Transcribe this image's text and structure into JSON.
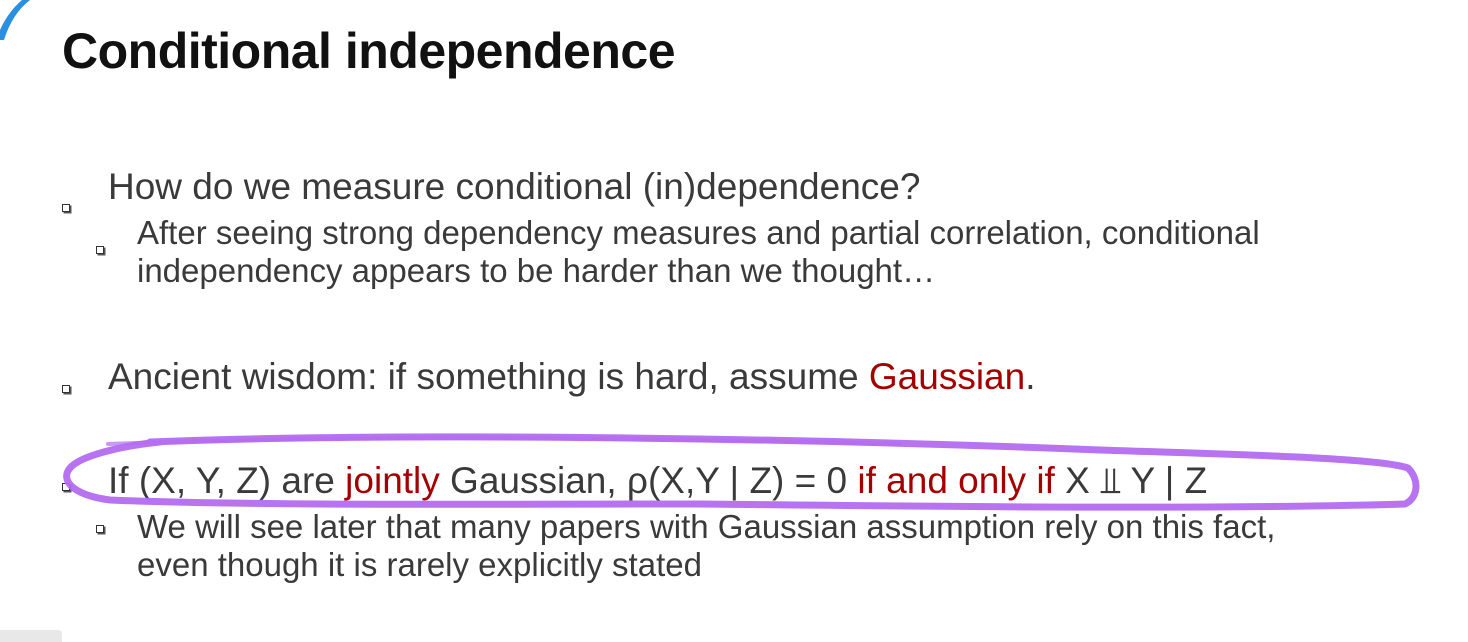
{
  "slide": {
    "title": "Conditional independence",
    "bullets": {
      "b1": {
        "text": "How do we measure conditional (in)dependence?",
        "sub": {
          "line1": "After seeing strong dependency measures and partial correlation, conditional",
          "line2": "independency appears to be harder than we thought…"
        }
      },
      "b2": {
        "before": "Ancient wisdom: if something is hard, assume ",
        "highlight": "Gaussian",
        "after": "."
      },
      "b3": {
        "part1": "If (X, Y, Z) are ",
        "highlight1": "jointly",
        "part2": " Gaussian, ρ(X,Y | Z) = 0 ",
        "highlight2": "if and only if",
        "part3": " X ⫫ Y | Z",
        "sub": {
          "line1": "We will see later that many papers with Gaussian assumption rely on this fact,",
          "line2": "even though it is rarely explicitly stated"
        }
      }
    }
  },
  "colors": {
    "emphasis": "#a30000",
    "annotation": "#b46cf0",
    "text": "#3a3a3a",
    "title": "#111111"
  }
}
